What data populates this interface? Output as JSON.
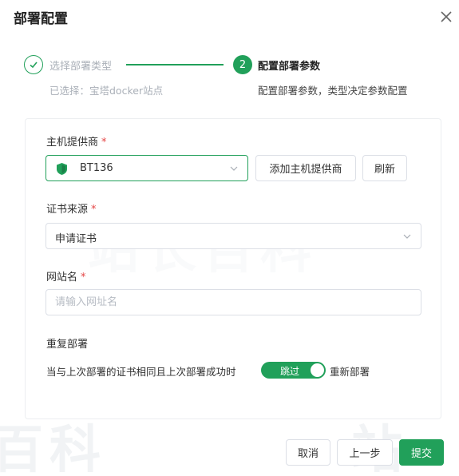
{
  "dialog": {
    "title": "部署配置"
  },
  "steps": [
    {
      "number": "✓",
      "title": "选择部署类型",
      "desc": "已选择：宝塔docker站点"
    },
    {
      "number": "2",
      "title": "配置部署参数",
      "desc": "配置部署参数，类型决定参数配置"
    }
  ],
  "form": {
    "host_provider": {
      "label": "主机提供商",
      "required": "*",
      "value": "BT136",
      "add_button": "添加主机提供商",
      "refresh_button": "刷新"
    },
    "cert_source": {
      "label": "证书来源",
      "required": "*",
      "value": "申请证书"
    },
    "site_name": {
      "label": "网站名",
      "required": "*",
      "placeholder": "请输入网址名",
      "value": ""
    },
    "redeploy": {
      "label": "重复部署",
      "condition_text": "当与上次部署的证书相同且上次部署成功时",
      "toggle_label": "跳过",
      "alt_option": "重新部署"
    }
  },
  "footer": {
    "cancel": "取消",
    "prev": "上一步",
    "submit": "提交"
  },
  "colors": {
    "accent": "#21a05a",
    "required": "#e54545"
  }
}
